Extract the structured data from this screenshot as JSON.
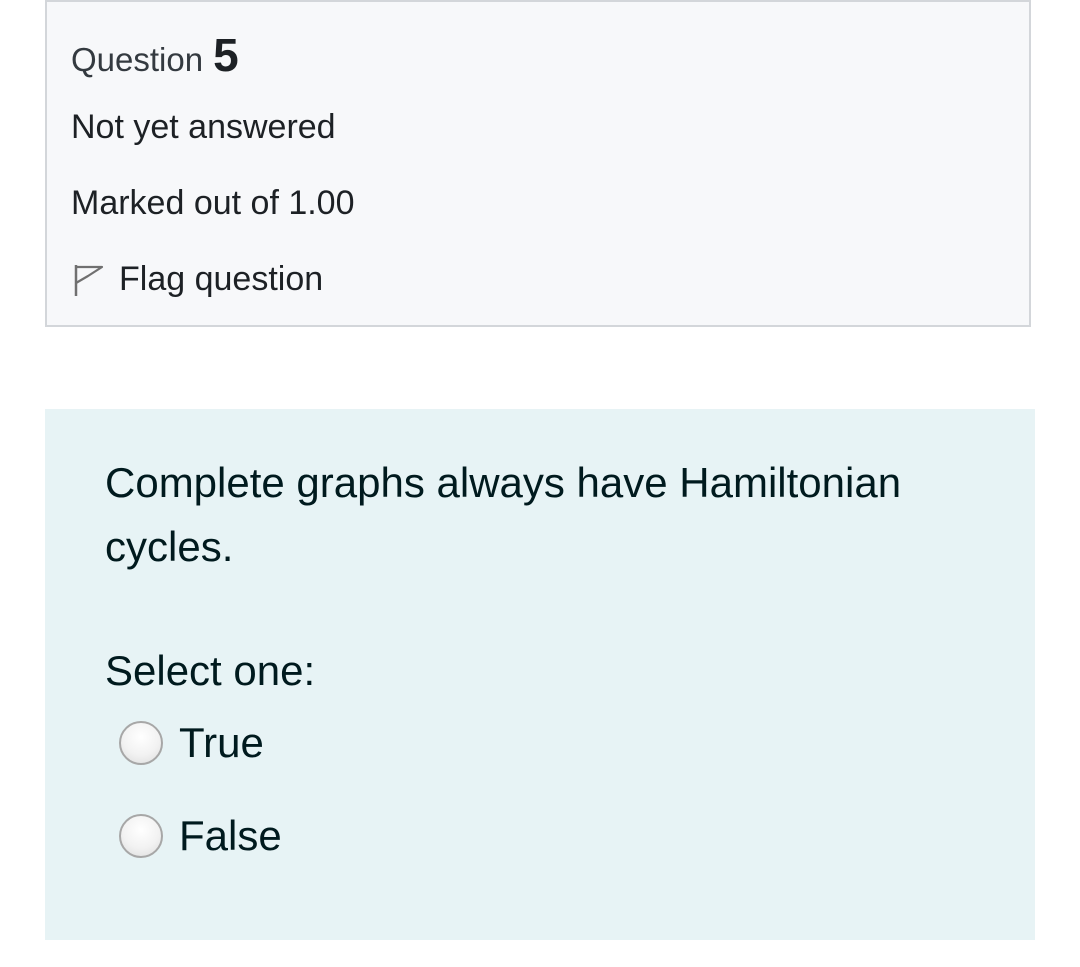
{
  "question_info": {
    "label": "Question",
    "number": "5",
    "state": "Not yet answered",
    "grade": "Marked out of 1.00",
    "flag_label": "Flag question",
    "flag_icon": "flag-outline-icon"
  },
  "question_content": {
    "text": "Complete graphs always have Hamiltonian cycles.",
    "prompt": "Select one:",
    "options": [
      {
        "label": "True",
        "selected": false
      },
      {
        "label": "False",
        "selected": false
      }
    ]
  },
  "colors": {
    "info_background": "#f7f8fa",
    "info_border": "#d3d6da",
    "content_background": "#e7f3f5"
  }
}
